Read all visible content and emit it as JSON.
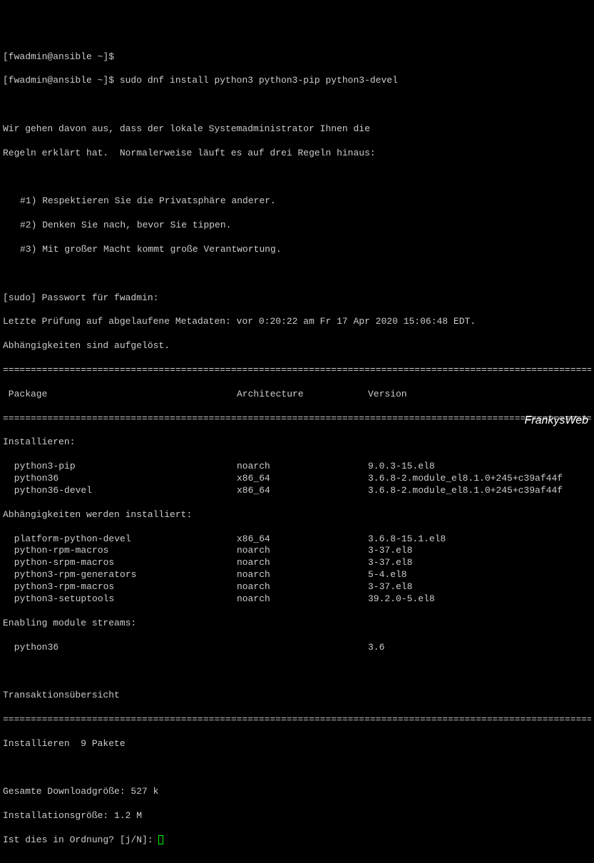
{
  "prompt1": "[fwadmin@ansible ~]$",
  "prompt2": "[fwadmin@ansible ~]$ sudo dnf install python3 python3-pip python3-devel",
  "intro1": "Wir gehen davon aus, dass der lokale Systemadministrator Ihnen die",
  "intro2": "Regeln erklärt hat.  Normalerweise läuft es auf drei Regeln hinaus:",
  "rule1": "#1) Respektieren Sie die Privatsphäre anderer.",
  "rule2": "#2) Denken Sie nach, bevor Sie tippen.",
  "rule3": "#3) Mit großer Macht kommt große Verantwortung.",
  "sudo_prompt": "[sudo] Passwort für fwadmin:",
  "meta_line": "Letzte Prüfung auf abgelaufene Metadaten: vor 0:20:22 am Fr 17 Apr 2020 15:06:48 EDT.",
  "deps_line": "Abhängigkeiten sind aufgelöst.",
  "divider": "================================================================================================================",
  "headers": {
    "package": " Package",
    "arch": "Architecture",
    "version": "Version"
  },
  "install_label": "Installieren:",
  "install_pkgs": [
    {
      "name": " python3-pip",
      "arch": "noarch",
      "version": "9.0.3-15.el8"
    },
    {
      "name": " python36",
      "arch": "x86_64",
      "version": "3.6.8-2.module_el8.1.0+245+c39af44f"
    },
    {
      "name": " python36-devel",
      "arch": "x86_64",
      "version": "3.6.8-2.module_el8.1.0+245+c39af44f"
    }
  ],
  "deps_label": "Abhängigkeiten werden installiert:",
  "deps_pkgs": [
    {
      "name": " platform-python-devel",
      "arch": "x86_64",
      "version": "3.6.8-15.1.el8"
    },
    {
      "name": " python-rpm-macros",
      "arch": "noarch",
      "version": "3-37.el8"
    },
    {
      "name": " python-srpm-macros",
      "arch": "noarch",
      "version": "3-37.el8"
    },
    {
      "name": " python3-rpm-generators",
      "arch": "noarch",
      "version": "5-4.el8"
    },
    {
      "name": " python3-rpm-macros",
      "arch": "noarch",
      "version": "3-37.el8"
    },
    {
      "name": " python3-setuptools",
      "arch": "noarch",
      "version": "39.2.0-5.el8"
    }
  ],
  "streams_label": "Enabling module streams:",
  "streams_pkgs": [
    {
      "name": " python36",
      "arch": "",
      "version": "3.6"
    }
  ],
  "trans_label": "Transaktionsübersicht",
  "summary_install": "Installieren  9 Pakete",
  "download_size": "Gesamte Downloadgröße: 527 k",
  "install_size": "Installationsgröße: 1.2 M",
  "confirm_prompt": "Ist dies in Ordnung? [j/N]: ",
  "watermark": "FrankysWeb"
}
